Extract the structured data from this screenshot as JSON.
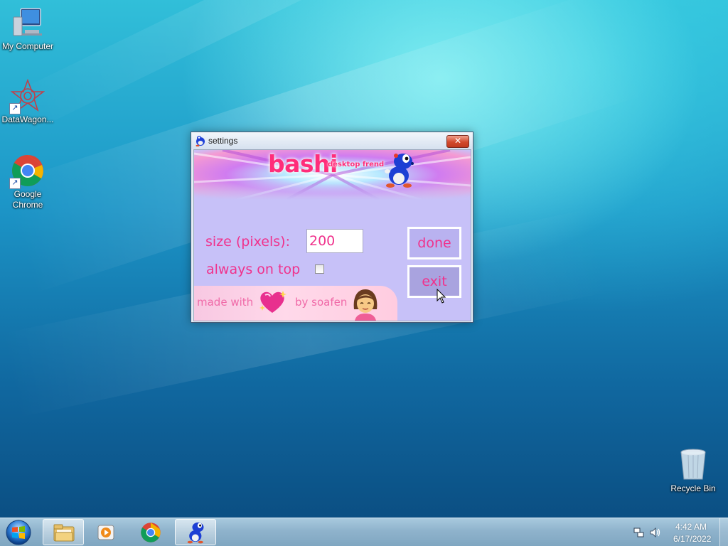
{
  "desktop": {
    "icons": [
      {
        "label": "My Computer",
        "icon": "computer-icon"
      },
      {
        "label": "DataWagon...",
        "icon": "datawagon-icon"
      },
      {
        "label": "Google Chrome",
        "icon": "chrome-icon"
      },
      {
        "label": "Recycle Bin",
        "icon": "recycle-bin-icon"
      }
    ]
  },
  "window": {
    "title": "settings",
    "close_label": "✕",
    "banner": {
      "logo": "bashi",
      "tagline": "desktop frend"
    },
    "size_label": "size (pixels):",
    "size_value": "200",
    "ontop_label": "always on top",
    "ontop_checked": false,
    "done_label": "done",
    "exit_label": "exit",
    "credit_made": "made with",
    "credit_by": "by soafen"
  },
  "taskbar": {
    "items": [
      "start-orb-icon",
      "file-explorer-icon",
      "media-player-icon",
      "chrome-icon",
      "bashi-icon"
    ],
    "clock_time": "4:42 AM",
    "clock_date": "6/17/2022"
  },
  "colors": {
    "accent_pink": "#f0328c",
    "client_bg": "#c7c1f8"
  }
}
